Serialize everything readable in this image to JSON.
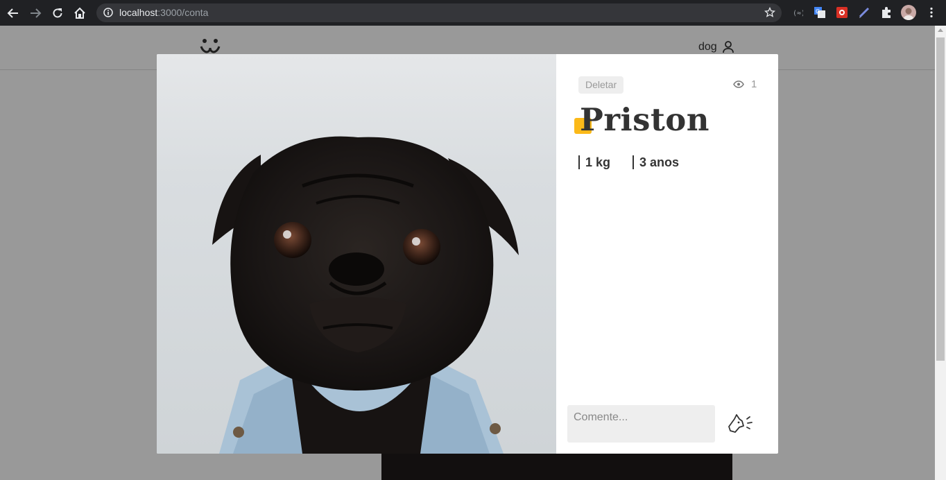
{
  "browser": {
    "url_host": "localhost",
    "url_path": ":3000/conta"
  },
  "header": {
    "user_name": "dog"
  },
  "modal": {
    "delete_label": "Deletar",
    "views_count": "1",
    "pet_name": "Priston",
    "weight": "1 kg",
    "age": "3 anos",
    "comment_placeholder": "Comente...",
    "accent_color": "#fbb919"
  }
}
